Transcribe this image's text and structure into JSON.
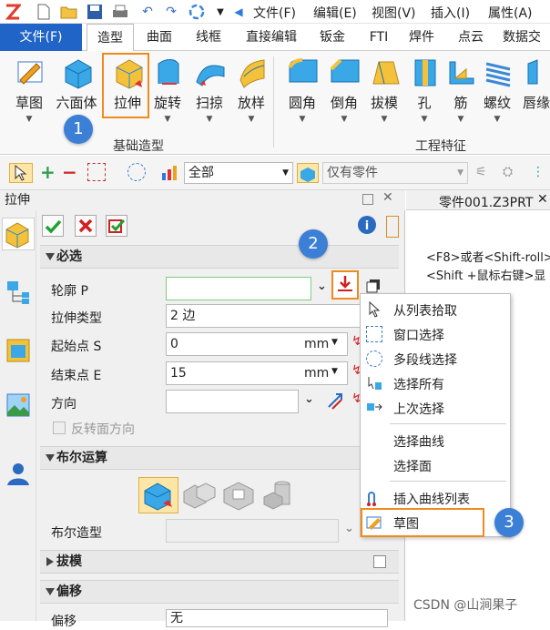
{
  "menubar": {
    "items": [
      "文件(F)",
      "编辑(E)",
      "视图(V)",
      "插入(I)",
      "属性(A)"
    ]
  },
  "ribbon_tabs": [
    "文件(F)",
    "造型",
    "曲面",
    "线框",
    "直接编辑",
    "钣金",
    "FTI",
    "焊件",
    "点云",
    "数据交"
  ],
  "ribbon": {
    "buttons": [
      "草图",
      "六面体",
      "拉伸",
      "旋转",
      "扫掠",
      "放样",
      "圆角",
      "倒角",
      "拔模",
      "孔",
      "筋",
      "螺纹",
      "唇缘"
    ],
    "groups": [
      "基础造型",
      "工程特征"
    ]
  },
  "toolbar2": {
    "filter_value": "全部",
    "part_filter": "仅有零件"
  },
  "panel": {
    "title": "拉伸",
    "sections": {
      "required": "必选",
      "boolean": "布尔运算",
      "draft": "拔模",
      "offset": "偏移"
    },
    "fields": {
      "profile_label": "轮廓 P",
      "profile_value": "",
      "type_label": "拉伸类型",
      "type_value": "2 边",
      "start_label": "起始点 S",
      "start_value": "0",
      "end_label": "结束点 E",
      "end_value": "15",
      "unit": "mm",
      "direction_label": "方向",
      "direction_value": "",
      "reverse_label": "反转面方向",
      "boolean_label": "布尔造型",
      "offset_label": "偏移",
      "offset_value": "无"
    }
  },
  "viewport": {
    "tab_label": "零件001.Z3PRT",
    "hint1": "<F8>或者<Shift-roll>",
    "hint2": "<Shift +鼠标右键>显"
  },
  "context_menu": {
    "items": [
      "从列表拾取",
      "窗口选择",
      "多段线选择",
      "选择所有",
      "上次选择",
      "选择曲线",
      "选择面",
      "插入曲线列表",
      "草图"
    ]
  },
  "callouts": [
    "1",
    "2",
    "3"
  ],
  "watermark": "CSDN @山涧果子",
  "colors": {
    "accent": "#1f64c6",
    "highlight": "#f08a1c",
    "callout": "#3c7fd6"
  }
}
